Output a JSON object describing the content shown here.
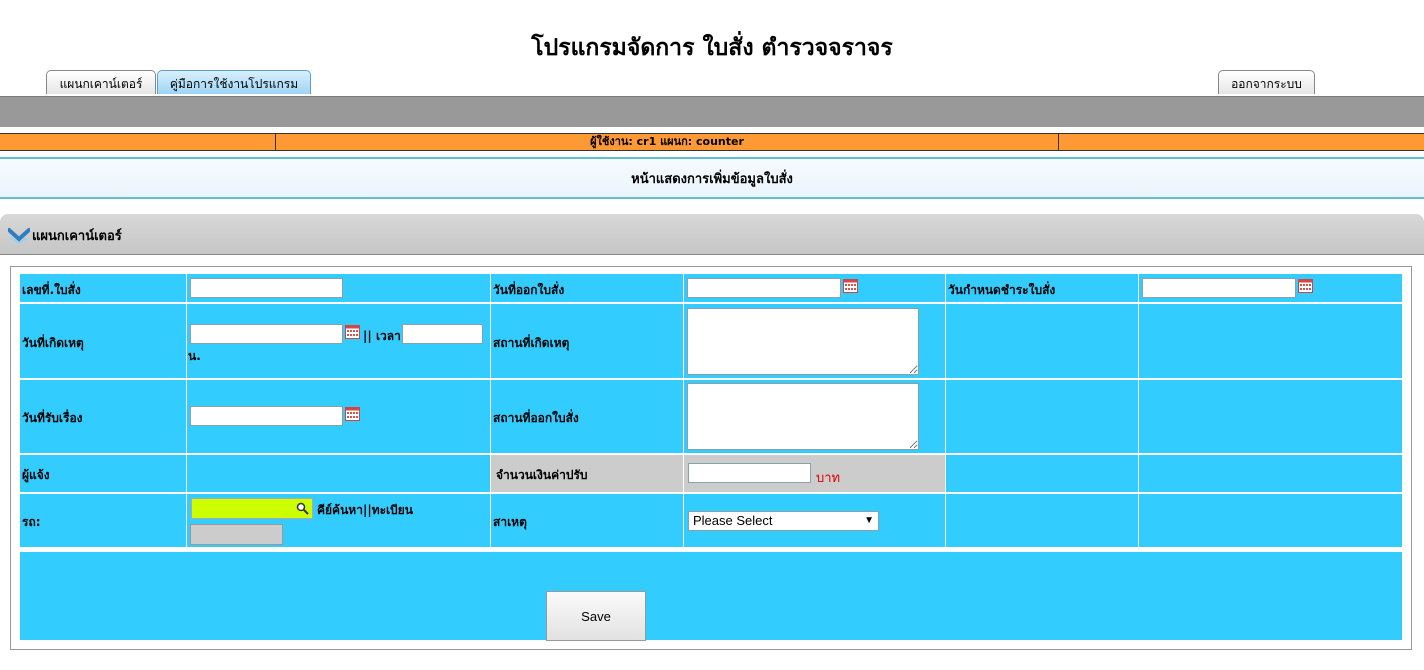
{
  "app": {
    "title": "โปรแกรมจัดการ ใบสั่ง ตำรวจจราจร"
  },
  "tabs": [
    {
      "label": "แผนกเคาน์เตอร์"
    },
    {
      "label": "คู่มือการใช้งานโปรแกรม"
    }
  ],
  "logout_label": "ออกจากระบบ",
  "userbar": {
    "text": "ผู้ใช้งาน: cr1    แผนก: counter"
  },
  "page_heading": "หน้าแสดงการเพิ่มข้อมูลใบสั่ง",
  "section": {
    "title": "แผนกเคาน์เตอร์"
  },
  "form": {
    "ticket_no_label": "เลขที่.ใบสั่ง",
    "issue_date_label": "วันที่ออกใบสั่ง",
    "due_date_label": "วันกำหนดชำระใบสั่ง",
    "incident_date_label": "วันที่เกิดเหตุ",
    "time_label": "|| เวลา",
    "time_unit": "น.",
    "incident_place_label": "สถานที่เกิดเหตุ",
    "received_date_label": "วันที่รับเรื่อง",
    "issue_place_label": "สถานที่ออกใบสั่ง",
    "reporter_label": "ผู้แจ้ง",
    "fine_label": "จำนวนเงินค่าปรับ",
    "fine_unit": "บาท",
    "vehicle_label": "รถ:",
    "vehicle_search_hint": "คีย์ค้นหา||ทะเบียน",
    "cause_label": "สาเหตุ",
    "cause_select": "Please Select",
    "save_label": "Save"
  },
  "colors": {
    "form_bg": "#33ccff",
    "orange_bar": "#ff9933",
    "gray_bar": "#999999",
    "search_input_bg": "#ccff00"
  }
}
